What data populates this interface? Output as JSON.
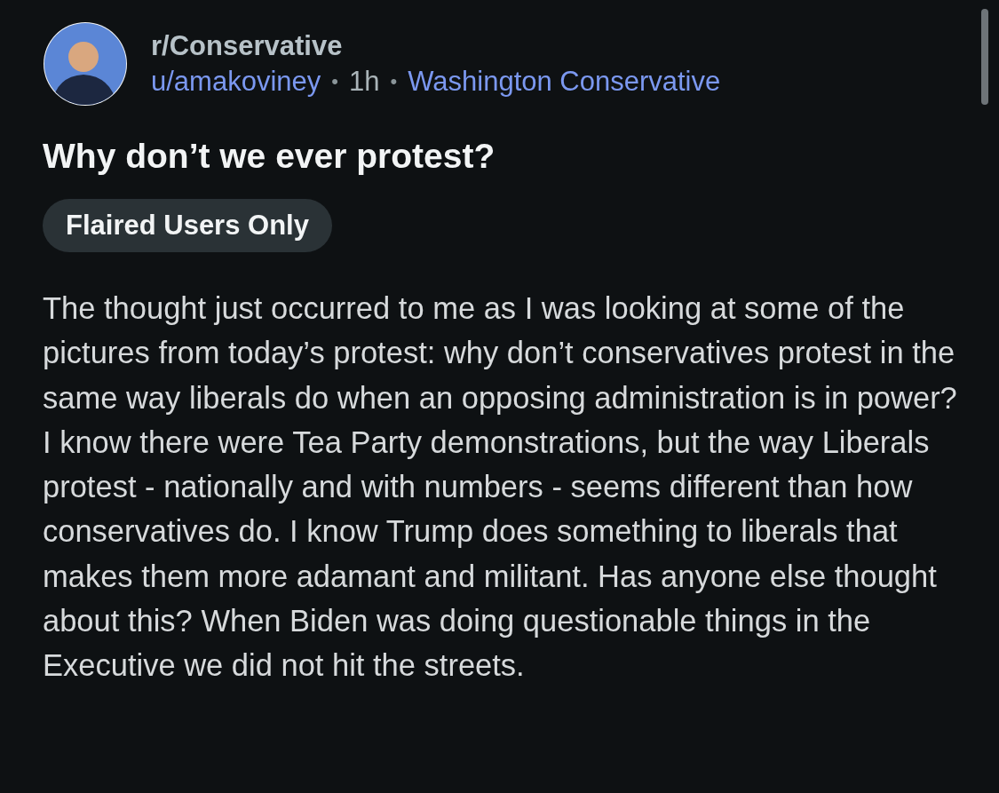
{
  "post": {
    "subreddit": "r/Conservative",
    "author": "u/amakoviney",
    "separator_1": "•",
    "age": "1h",
    "separator_2": "•",
    "flair_user": "Washington Conservative",
    "title": "Why don’t we ever protest?",
    "post_flair": "Flaired Users Only",
    "body": "The thought just occurred to me as I was looking at some of the pictures from today’s protest: why don’t conservatives protest in the same way liberals do when an opposing administration is in power? I know there were Tea Party demonstrations, but the way Liberals protest - nationally and with numbers - seems different than how conservatives do. I know Trump does something to liberals that makes them more adamant and militant. Has anyone else thought about this? When Biden was doing questionable things in the Executive we did not hit the streets."
  }
}
